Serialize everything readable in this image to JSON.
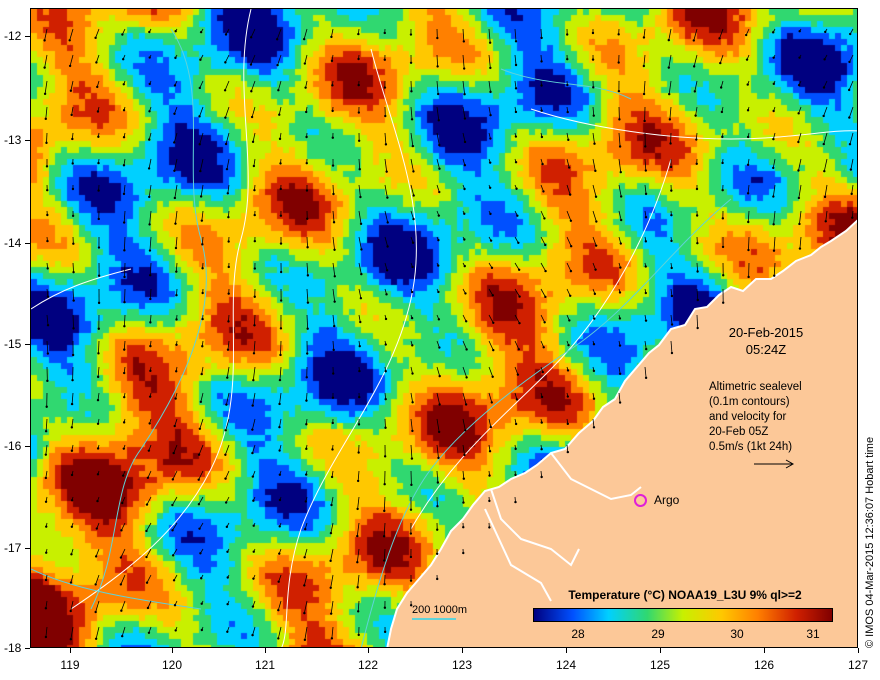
{
  "map": {
    "x_axis": {
      "ticks": [
        "119",
        "120",
        "121",
        "122",
        "123",
        "124",
        "125",
        "126",
        "127"
      ]
    },
    "y_axis": {
      "ticks": [
        "-12",
        "-13",
        "-14",
        "-15",
        "-16",
        "-17",
        "-18"
      ]
    }
  },
  "date": {
    "line1": "20-Feb-2015",
    "line2": "05:24Z"
  },
  "altimetry": {
    "line1": "Altimetric sealevel",
    "line2": "(0.1m contours)",
    "line3": "and velocity for",
    "line4": "20-Feb 05Z",
    "line5": "0.5m/s (1kt 24h)"
  },
  "argo": {
    "label": "Argo",
    "color": "#e020d8"
  },
  "colorbar": {
    "title": "Temperature (°C) NOAA19_L3U 9% ql>=2",
    "labels": [
      "28",
      "29",
      "30",
      "31"
    ],
    "colors": [
      "#000080",
      "#0050ff",
      "#00d0ff",
      "#30d870",
      "#c8f000",
      "#ffc800",
      "#ff8000",
      "#d02000",
      "#800000"
    ]
  },
  "depth_legend": {
    "label": "200  1000m",
    "color": "#5fd3d8"
  },
  "credit": "© IMOS 04-Mar-2015 12:36:07 Hobart time",
  "colors": {
    "land": "#fcc898",
    "coast": "#ffffff",
    "contour": "#ffffff",
    "bathy": "#5fd3d8"
  }
}
